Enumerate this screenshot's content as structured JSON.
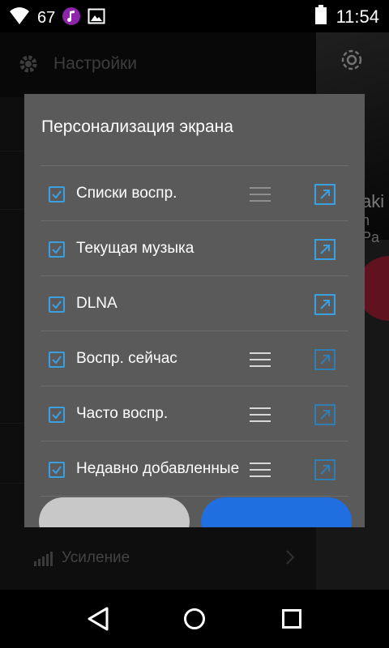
{
  "status_bar": {
    "notification_count": "67",
    "time": "11:54",
    "icons": [
      "wifi-icon",
      "music-app-icon",
      "image-icon",
      "battery-icon"
    ]
  },
  "background": {
    "header_title": "Настройки",
    "gear_icon": "gear-icon",
    "art_text_1": "aki",
    "art_text_2": "n Pa",
    "row_label": "Усиление"
  },
  "dialog": {
    "title": "Персонализация экрана",
    "items": [
      {
        "label": "Списки воспр.",
        "checked": true,
        "has_drag_handle": true,
        "drag_dim": true,
        "link_active": true
      },
      {
        "label": "Текущая музыка",
        "checked": true,
        "has_drag_handle": false,
        "drag_dim": false,
        "link_active": true
      },
      {
        "label": "DLNA",
        "checked": true,
        "has_drag_handle": false,
        "drag_dim": false,
        "link_active": true
      },
      {
        "label": "Воспр. сейчас",
        "checked": true,
        "has_drag_handle": true,
        "drag_dim": false,
        "link_active": false
      },
      {
        "label": "Часто воспр.",
        "checked": true,
        "has_drag_handle": true,
        "drag_dim": false,
        "link_active": false
      },
      {
        "label": "Недавно добавленные",
        "checked": true,
        "has_drag_handle": true,
        "drag_dim": false,
        "link_active": false
      }
    ]
  },
  "colors": {
    "accent_blue": "#3aa0e0",
    "dialog_bg": "#5a5a5a",
    "ok_button": "#1f6fe0",
    "cancel_button": "#c8c8c8",
    "art_circle": "#b0243a"
  },
  "navigation": {
    "icons": [
      "back-icon",
      "home-icon",
      "recent-apps-icon"
    ]
  }
}
